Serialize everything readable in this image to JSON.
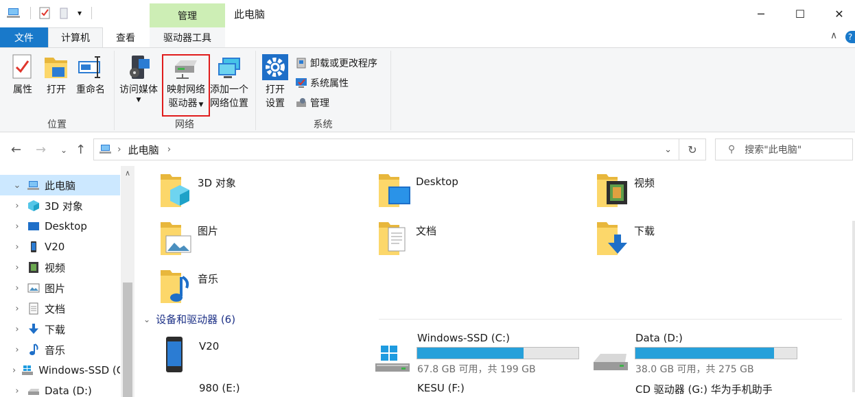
{
  "titlebar": {
    "title": "此电脑",
    "manage_tab": "管理",
    "qat_dropdown": "▾",
    "minimize": "─",
    "maximize": "☐",
    "close": "✕"
  },
  "tabs": {
    "file": "文件",
    "computer": "计算机",
    "view": "查看",
    "drive_tools": "驱动器工具",
    "collapse_icon": "∧",
    "help_icon": "?"
  },
  "ribbon": {
    "location": {
      "label": "位置",
      "properties": "属性",
      "open": "打开",
      "rename": "重命名"
    },
    "network": {
      "label": "网络",
      "access_media_line1": "访问媒体",
      "map_drive_line1": "映射网络",
      "map_drive_line2": "驱动器",
      "add_location_line1": "添加一个",
      "add_location_line2": "网络位置"
    },
    "system": {
      "label": "系统",
      "open_settings_line1": "打开",
      "open_settings_line2": "设置",
      "uninstall": "卸载或更改程序",
      "system_properties": "系统属性",
      "manage": "管理"
    }
  },
  "address": {
    "path": "此电脑",
    "path_sep": "›",
    "search_placeholder": "搜索\"此电脑\""
  },
  "nav": {
    "items": [
      {
        "label": "此电脑"
      },
      {
        "label": "3D 对象"
      },
      {
        "label": "Desktop"
      },
      {
        "label": "V20"
      },
      {
        "label": "视频"
      },
      {
        "label": "图片"
      },
      {
        "label": "文档"
      },
      {
        "label": "下载"
      },
      {
        "label": "音乐"
      },
      {
        "label": "Windows-SSD (C:)"
      },
      {
        "label": "Data (D:)"
      }
    ]
  },
  "folders": [
    {
      "name": "3D 对象"
    },
    {
      "name": "Desktop"
    },
    {
      "name": "视频"
    },
    {
      "name": "图片"
    },
    {
      "name": "文档"
    },
    {
      "name": "下载"
    },
    {
      "name": "音乐"
    }
  ],
  "devices": {
    "header": "设备和驱动器 (6)",
    "items": [
      {
        "name": "V20"
      },
      {
        "name": "Windows-SSD (C:)",
        "free": "67.8 GB 可用，共 199 GB",
        "used_fraction": 0.66
      },
      {
        "name": "Data (D:)",
        "free": "38.0 GB 可用，共 275 GB",
        "used_fraction": 0.86
      },
      {
        "name": "980 (E:)"
      },
      {
        "name": "KESU (F:)"
      },
      {
        "name": "CD 驱动器 (G:) 华为手机助手"
      }
    ]
  },
  "colors": {
    "accent": "#1979ca",
    "manage_tab": "#cdeeb5",
    "selection": "#cce8ff",
    "drive_bar": "#26a0da",
    "highlight": "#e01b1b"
  }
}
